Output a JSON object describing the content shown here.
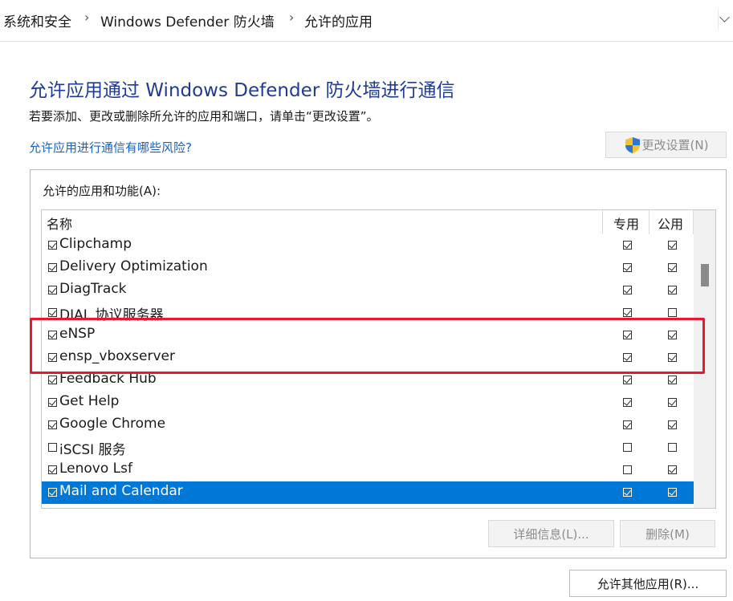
{
  "breadcrumb": {
    "items": [
      "系统和安全",
      "Windows Defender 防火墙",
      "允许的应用"
    ],
    "separator": "›"
  },
  "title": "允许应用通过 Windows Defender 防火墙进行通信",
  "description": "若要添加、更改或删除所允许的应用和端口，请单击“更改设置”。",
  "risk_link": "允许应用进行通信有哪些风险?",
  "change_settings_button": "更改设置(N)",
  "group": {
    "label": "允许的应用和功能(A):",
    "columns": {
      "name": "名称",
      "private": "专用",
      "public": "公用"
    },
    "rows": [
      {
        "name": "Clipchamp",
        "enabled": true,
        "private": true,
        "public": true
      },
      {
        "name": "Delivery Optimization",
        "enabled": true,
        "private": true,
        "public": true
      },
      {
        "name": "DiagTrack",
        "enabled": true,
        "private": true,
        "public": true
      },
      {
        "name": "DIAL 协议服务器",
        "enabled": true,
        "private": true,
        "public": false
      },
      {
        "name": "eNSP",
        "enabled": true,
        "private": true,
        "public": true
      },
      {
        "name": "ensp_vboxserver",
        "enabled": true,
        "private": true,
        "public": true
      },
      {
        "name": "Feedback Hub",
        "enabled": true,
        "private": true,
        "public": true
      },
      {
        "name": "Get Help",
        "enabled": true,
        "private": true,
        "public": true
      },
      {
        "name": "Google Chrome",
        "enabled": true,
        "private": true,
        "public": true
      },
      {
        "name": "iSCSI 服务",
        "enabled": false,
        "private": false,
        "public": false
      },
      {
        "name": "Lenovo Lsf",
        "enabled": true,
        "private": false,
        "public": true
      },
      {
        "name": "Mail and Calendar",
        "enabled": true,
        "private": true,
        "public": true,
        "selected": true
      }
    ],
    "details_button": "详细信息(L)...",
    "remove_button": "删除(M)"
  },
  "allow_other_button": "允许其他应用(R)...",
  "colors": {
    "title": "#1e3c96",
    "link": "#1664c8",
    "selection": "#0078d7",
    "highlight_box": "#e8192c"
  },
  "icons": {
    "change_settings": "uac-shield-icon",
    "breadcrumb_dropdown": "chevron-down-icon"
  }
}
